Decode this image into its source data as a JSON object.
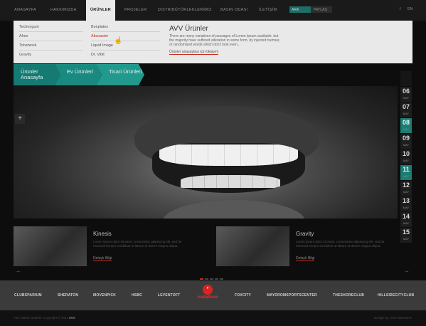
{
  "nav": {
    "items": [
      "ANASAYFA",
      "HAKKIMIZDA",
      "ÜRÜNLER",
      "PROJELER",
      "DISTRIBÜTÖRLEKLERİMİZ",
      "BASIN ODASI",
      "İLETİŞİM"
    ],
    "search_value": "ARA",
    "search_button": "PAYLAŞ",
    "lang": [
      "f",
      "EN"
    ]
  },
  "dropdown": {
    "col1": [
      "Technogum",
      "Alrex",
      "Tohahevik",
      "Gravity"
    ],
    "col2": [
      "Bonplates",
      "Abcoaster",
      "Liquid Image",
      "Dr. Vibit"
    ],
    "preview_title": "AVV Ürünler",
    "preview_text": "There are many variations of passages of Lorem Ipsum available, but the majority have suffered alteration in some form, by injected humour, or randomised words which don't look even...",
    "preview_link": "Ürünler anasayfası için tıklayın!"
  },
  "breadcrumb": [
    "Ürünler Anasayfa",
    "Ev Ürünleri",
    "Ticari Ürünleri"
  ],
  "dates": [
    {
      "d": "",
      "m": "",
      "style": "dim"
    },
    {
      "d": "06",
      "m": "MAY",
      "style": ""
    },
    {
      "d": "07",
      "m": "MAY",
      "style": ""
    },
    {
      "d": "08",
      "m": "MAY",
      "style": "teal"
    },
    {
      "d": "09",
      "m": "MAY",
      "style": ""
    },
    {
      "d": "10",
      "m": "MAY",
      "style": ""
    },
    {
      "d": "11",
      "m": "MAY",
      "style": "teal"
    },
    {
      "d": "12",
      "m": "MAY",
      "style": ""
    },
    {
      "d": "13",
      "m": "MAY",
      "style": ""
    },
    {
      "d": "14",
      "m": "MAY",
      "style": ""
    },
    {
      "d": "15",
      "m": "MAY",
      "style": ""
    }
  ],
  "news": [
    {
      "title": "Kinesis",
      "text": "Lorem ipsum dolor sit amet, consectetur adipiscing elit, sed do eiusmod tempor incididunt ut labore et dolore magna aliqua.",
      "more": "Detaylı Bilgi"
    },
    {
      "title": "Gravity",
      "text": "Lorem ipsum dolor sit amet, consectetur adipiscing elit, sed do eiusmod tempor incididunt ut labore et dolore magna aliqua.",
      "more": "Detaylı Bilgi"
    }
  ],
  "clients": [
    "CLUBSPARIUM",
    "SHERATON",
    "MOVENPICK",
    "HSBC",
    "LEVENTOFT",
    "FOXCITY",
    "MAYDROMSPORTSCENTER",
    "THESHORECLUB",
    "HILLSIDECITYCLUB"
  ],
  "vodafone": "vodafone",
  "footer": {
    "copy": "Tüm hakları saklıdır. Copyright © 2011",
    "brand": "AVV",
    "design": "Design by: DJS Interactive"
  },
  "colors": {
    "accent_teal": "#1a7d74",
    "accent_red": "#c62c1e",
    "dropdown_bg": "#e9e9e9"
  }
}
